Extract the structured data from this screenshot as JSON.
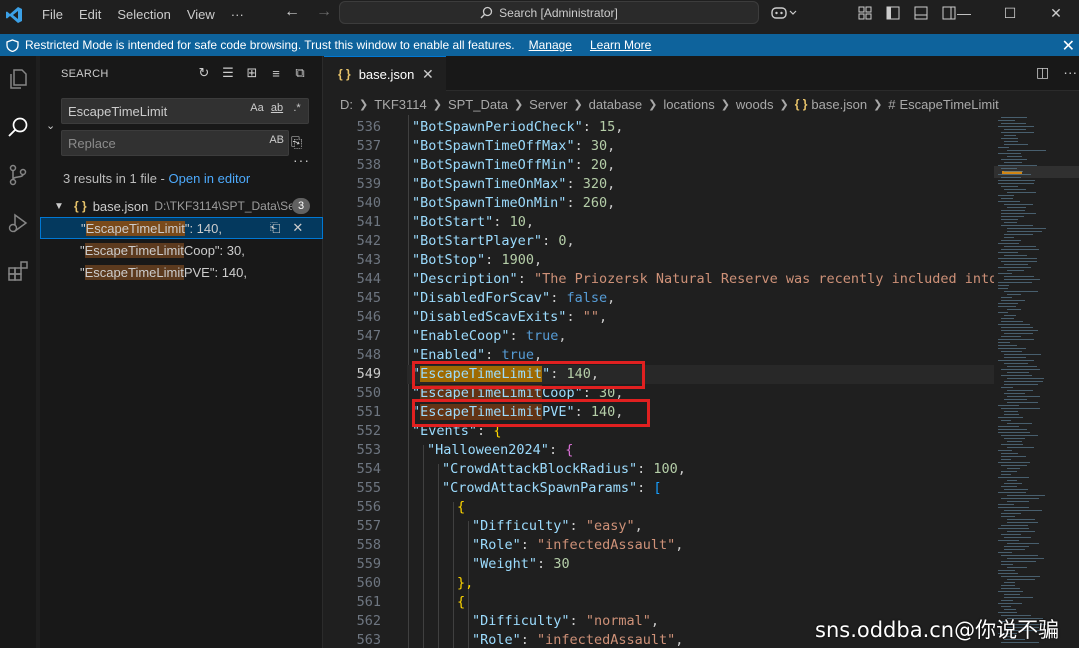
{
  "titlebar": {
    "menu": [
      "File",
      "Edit",
      "Selection",
      "View",
      "···"
    ],
    "search_label": "Search [Administrator]"
  },
  "banner": {
    "message": "Restricted Mode is intended for safe code browsing. Trust this window to enable all features.",
    "manage": "Manage",
    "learn_more": "Learn More"
  },
  "sidebar": {
    "title": "SEARCH",
    "search_value": "EscapeTimeLimit",
    "search_opts": [
      "Aa",
      "ab",
      ".*"
    ],
    "replace_placeholder": "Replace",
    "replace_opt": "AB",
    "summary": "3 results in 1 file - ",
    "open_in_editor": "Open in editor",
    "file": {
      "name": "base.json",
      "path": "D:\\TKF3114\\SPT_Data\\Se...",
      "count": "3"
    },
    "matches": [
      {
        "pre": "\"",
        "hl": "EscapeTimeLimit",
        "post": "\": 140,"
      },
      {
        "pre": "\"",
        "hl": "EscapeTimeLimit",
        "post": "Coop\": 30,"
      },
      {
        "pre": "\"",
        "hl": "EscapeTimeLimit",
        "post": "PVE\": 140,"
      }
    ]
  },
  "editor": {
    "tab": "base.json",
    "breadcrumb": [
      "D:",
      "TKF3114",
      "SPT_Data",
      "Server",
      "database",
      "locations",
      "woods",
      "base.json",
      "EscapeTimeLimit"
    ]
  },
  "code": {
    "current_line": 549,
    "lines": [
      {
        "n": "536",
        "key": "BotSpawnPeriodCheck",
        "val": "15",
        "t": "n",
        "indent": 0
      },
      {
        "n": "537",
        "key": "BotSpawnTimeOffMax",
        "val": "30",
        "t": "n",
        "indent": 0
      },
      {
        "n": "538",
        "key": "BotSpawnTimeOffMin",
        "val": "20",
        "t": "n",
        "indent": 0
      },
      {
        "n": "539",
        "key": "BotSpawnTimeOnMax",
        "val": "320",
        "t": "n",
        "indent": 0
      },
      {
        "n": "540",
        "key": "BotSpawnTimeOnMin",
        "val": "260",
        "t": "n",
        "indent": 0
      },
      {
        "n": "541",
        "key": "BotStart",
        "val": "10",
        "t": "n",
        "indent": 0
      },
      {
        "n": "542",
        "key": "BotStartPlayer",
        "val": "0",
        "t": "n",
        "indent": 0
      },
      {
        "n": "543",
        "key": "BotStop",
        "val": "1900",
        "t": "n",
        "indent": 0
      },
      {
        "n": "544",
        "key": "Description",
        "val": "\"The Priozersk Natural Reserve was recently included into th",
        "t": "s",
        "indent": 0
      },
      {
        "n": "545",
        "key": "DisabledForScav",
        "val": "false",
        "t": "b",
        "indent": 0
      },
      {
        "n": "546",
        "key": "DisabledScavExits",
        "val": "\"\"",
        "t": "s",
        "indent": 0
      },
      {
        "n": "547",
        "key": "EnableCoop",
        "val": "true",
        "t": "b",
        "indent": 0
      },
      {
        "n": "548",
        "key": "Enabled",
        "val": "true",
        "t": "b",
        "indent": 0
      },
      {
        "n": "549",
        "key": "EscapeTimeLimit",
        "val": "140",
        "t": "n",
        "indent": 0
      },
      {
        "n": "550",
        "key": "EscapeTimeLimitCoop",
        "val": "30",
        "t": "n",
        "indent": 0
      },
      {
        "n": "551",
        "key": "EscapeTimeLimitPVE",
        "val": "140",
        "t": "n",
        "indent": 0
      },
      {
        "n": "552",
        "key": "Events",
        "val": "{",
        "t": "o1",
        "indent": 0
      },
      {
        "n": "553",
        "key": "Halloween2024",
        "val": "{",
        "t": "o2",
        "indent": 1
      },
      {
        "n": "554",
        "key": "CrowdAttackBlockRadius",
        "val": "100",
        "t": "n",
        "indent": 2
      },
      {
        "n": "555",
        "key": "CrowdAttackSpawnParams",
        "val": "[",
        "t": "o3",
        "indent": 2
      },
      {
        "n": "556",
        "key": "",
        "val": "{",
        "t": "o1",
        "indent": 3
      },
      {
        "n": "557",
        "key": "Difficulty",
        "val": "\"easy\"",
        "t": "s",
        "indent": 4
      },
      {
        "n": "558",
        "key": "Role",
        "val": "\"infectedAssault\"",
        "t": "s",
        "indent": 4
      },
      {
        "n": "559",
        "key": "Weight",
        "val": "30",
        "t": "nl",
        "indent": 4
      },
      {
        "n": "560",
        "key": "",
        "val": "},",
        "t": "c1",
        "indent": 3
      },
      {
        "n": "561",
        "key": "",
        "val": "{",
        "t": "o1",
        "indent": 3
      },
      {
        "n": "562",
        "key": "Difficulty",
        "val": "\"normal\"",
        "t": "s",
        "indent": 4
      },
      {
        "n": "563",
        "key": "Role",
        "val": "\"infectedAssault\"",
        "t": "s",
        "indent": 4
      }
    ]
  },
  "watermark": "sns.oddba.cn@你说不骗人",
  "colors": {
    "accent": "#0078d4",
    "banner": "#0e639c",
    "highlight_box": "#e02020"
  }
}
